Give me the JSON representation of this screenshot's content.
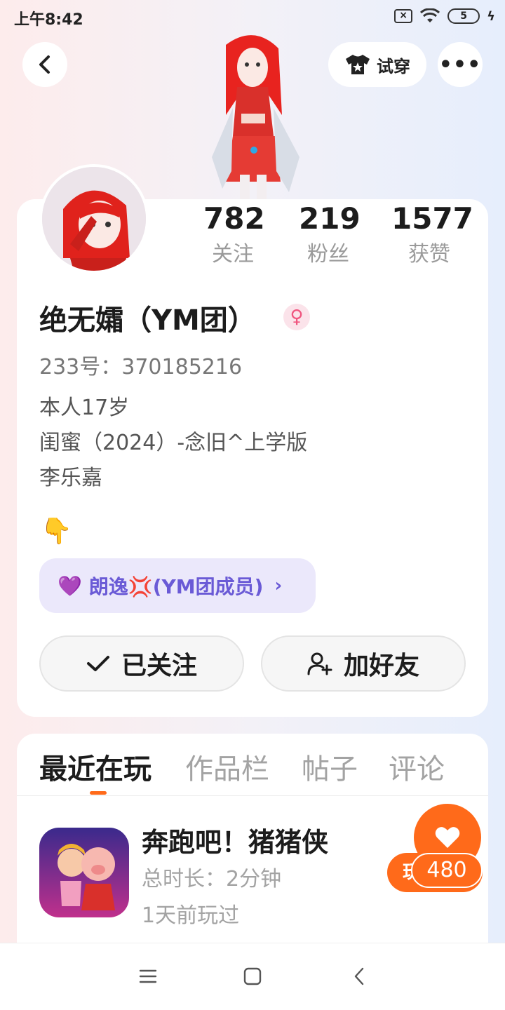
{
  "status_bar": {
    "time": "上午8:42",
    "sim_label": "×",
    "battery_level": "5",
    "charging_symbol": "ϟ"
  },
  "header": {
    "tryon_label": "试穿",
    "more_label": "•••"
  },
  "stats": [
    {
      "value": "782",
      "label": "关注"
    },
    {
      "value": "219",
      "label": "粉丝"
    },
    {
      "value": "1577",
      "label": "获赞"
    }
  ],
  "profile": {
    "nickname": "绝无孀（YM团）",
    "gender_symbol": "♀",
    "id_line": "233号：370185216",
    "bio": [
      "本人17岁",
      "闺蜜（2024）-念旧^上学版",
      "李乐嘉"
    ],
    "emoji": "👇"
  },
  "cp_tag": {
    "heart": "💜",
    "label": "朗逸💢(YM团成员)",
    "chevron": "›"
  },
  "actions": {
    "follow_label": "已关注",
    "add_friend_label": "加好友"
  },
  "tabs": [
    "最近在玩",
    "作品栏",
    "帖子",
    "评论"
  ],
  "recent_game": {
    "title": "奔跑吧！猪猪侠",
    "duration": "总时长：2分钟",
    "last_played": "1天前玩过",
    "play_label": "玩",
    "likes": "480"
  },
  "colors": {
    "accent": "#ff6a1a",
    "cp_tag_bg": "#ebe8fb",
    "cp_tag_text": "#6a5ad6",
    "gender_pink": "#f0557f"
  },
  "icons": [
    "back-arrow-icon",
    "tshirt-icon",
    "more-icon",
    "checkmark-icon",
    "add-user-icon",
    "heart-icon",
    "menu-icon",
    "home-square-icon",
    "nav-back-icon"
  ]
}
